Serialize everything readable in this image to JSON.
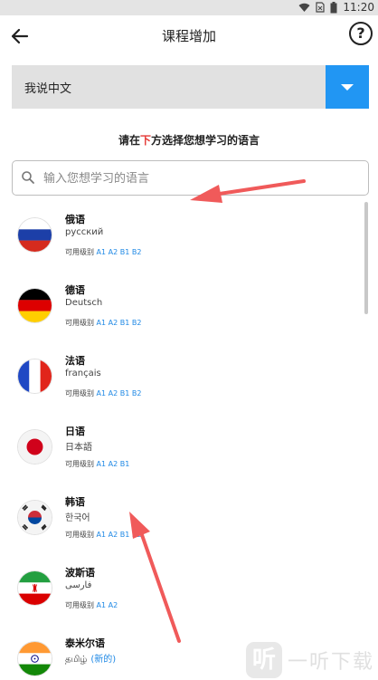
{
  "status_bar": {
    "time": "11:20"
  },
  "header": {
    "title": "课程增加",
    "help_symbol": "?"
  },
  "native_language": {
    "selected": "我说中文"
  },
  "instruction": {
    "before": "请在",
    "highlight": "下",
    "after": "方选择您想学习的语言"
  },
  "search": {
    "placeholder": "输入您想学习的语言",
    "value": ""
  },
  "languages": [
    {
      "name": "俄语",
      "native": "русский",
      "levels_label": "可用级别",
      "levels": "A1 A2 B1 B2",
      "flag": "russia-flag-icon",
      "new_tag": ""
    },
    {
      "name": "德语",
      "native": "Deutsch",
      "levels_label": "可用级别",
      "levels": "A1 A2 B1 B2",
      "flag": "germany-flag-icon",
      "new_tag": ""
    },
    {
      "name": "法语",
      "native": "français",
      "levels_label": "可用级别",
      "levels": "A1 A2 B1 B2",
      "flag": "france-flag-icon",
      "new_tag": ""
    },
    {
      "name": "日语",
      "native": "日本語",
      "levels_label": "可用级别",
      "levels": "A1 A2 B1",
      "flag": "japan-flag-icon",
      "new_tag": ""
    },
    {
      "name": "韩语",
      "native": "한국어",
      "levels_label": "可用级别",
      "levels": "A1 A2 B1 B2",
      "flag": "korea-flag-icon",
      "new_tag": ""
    },
    {
      "name": "波斯语",
      "native": "فارسی",
      "levels_label": "可用级别",
      "levels": "A1 A2",
      "flag": "iran-flag-icon",
      "new_tag": ""
    },
    {
      "name": "泰米尔语",
      "native": "தமிழ்",
      "levels_label": "",
      "levels": "",
      "flag": "india-flag-icon",
      "new_tag": "(新的)"
    }
  ],
  "watermark": {
    "logo": "听",
    "text": "一听下载"
  },
  "colors": {
    "accent": "#2196f3",
    "highlight": "#e53935",
    "level": "#1e88e5",
    "arrow": "#f05a5a"
  }
}
